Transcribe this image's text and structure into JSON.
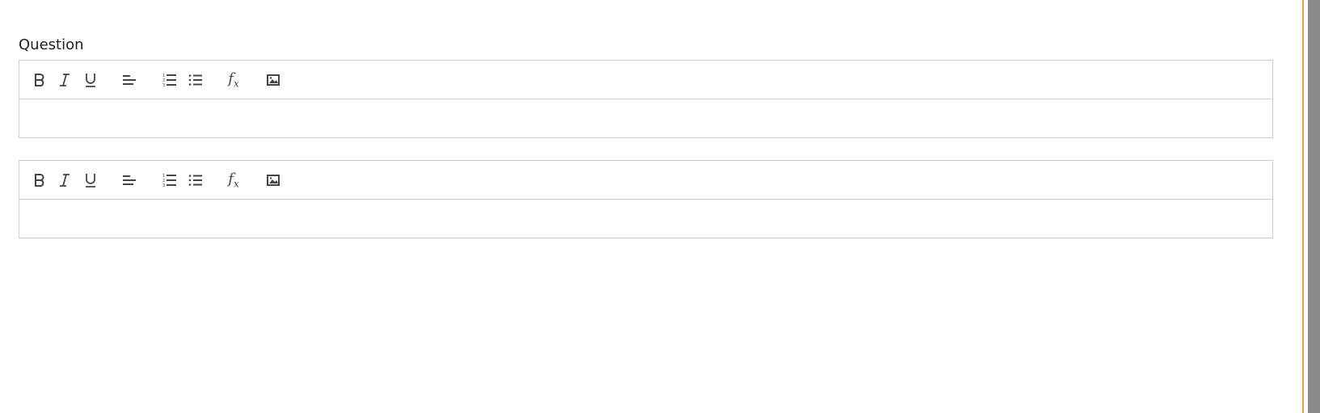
{
  "question_label": "Question",
  "editors": [
    {
      "name": "question-editor",
      "tools": [
        {
          "name": "bold",
          "icon": "bold-icon"
        },
        {
          "name": "italic",
          "icon": "italic-icon"
        },
        {
          "name": "underline",
          "icon": "underline-icon"
        },
        {
          "name": "align-left",
          "icon": "align-left-icon"
        },
        {
          "name": "ordered-list",
          "icon": "ordered-list-icon"
        },
        {
          "name": "unordered-list",
          "icon": "unordered-list-icon"
        },
        {
          "name": "formula",
          "icon": "formula-icon"
        },
        {
          "name": "image",
          "icon": "image-icon"
        }
      ],
      "value": ""
    },
    {
      "name": "answer-editor",
      "tools": [
        {
          "name": "bold",
          "icon": "bold-icon"
        },
        {
          "name": "italic",
          "icon": "italic-icon"
        },
        {
          "name": "underline",
          "icon": "underline-icon"
        },
        {
          "name": "align-left",
          "icon": "align-left-icon"
        },
        {
          "name": "ordered-list",
          "icon": "ordered-list-icon"
        },
        {
          "name": "unordered-list",
          "icon": "unordered-list-icon"
        },
        {
          "name": "formula",
          "icon": "formula-icon"
        },
        {
          "name": "image",
          "icon": "image-icon"
        }
      ],
      "value": ""
    }
  ],
  "colors": {
    "border": "#cfcfcf",
    "icon": "#444444",
    "accent_edge": "#f0a050",
    "scrollbar": "#8a8a8a"
  }
}
